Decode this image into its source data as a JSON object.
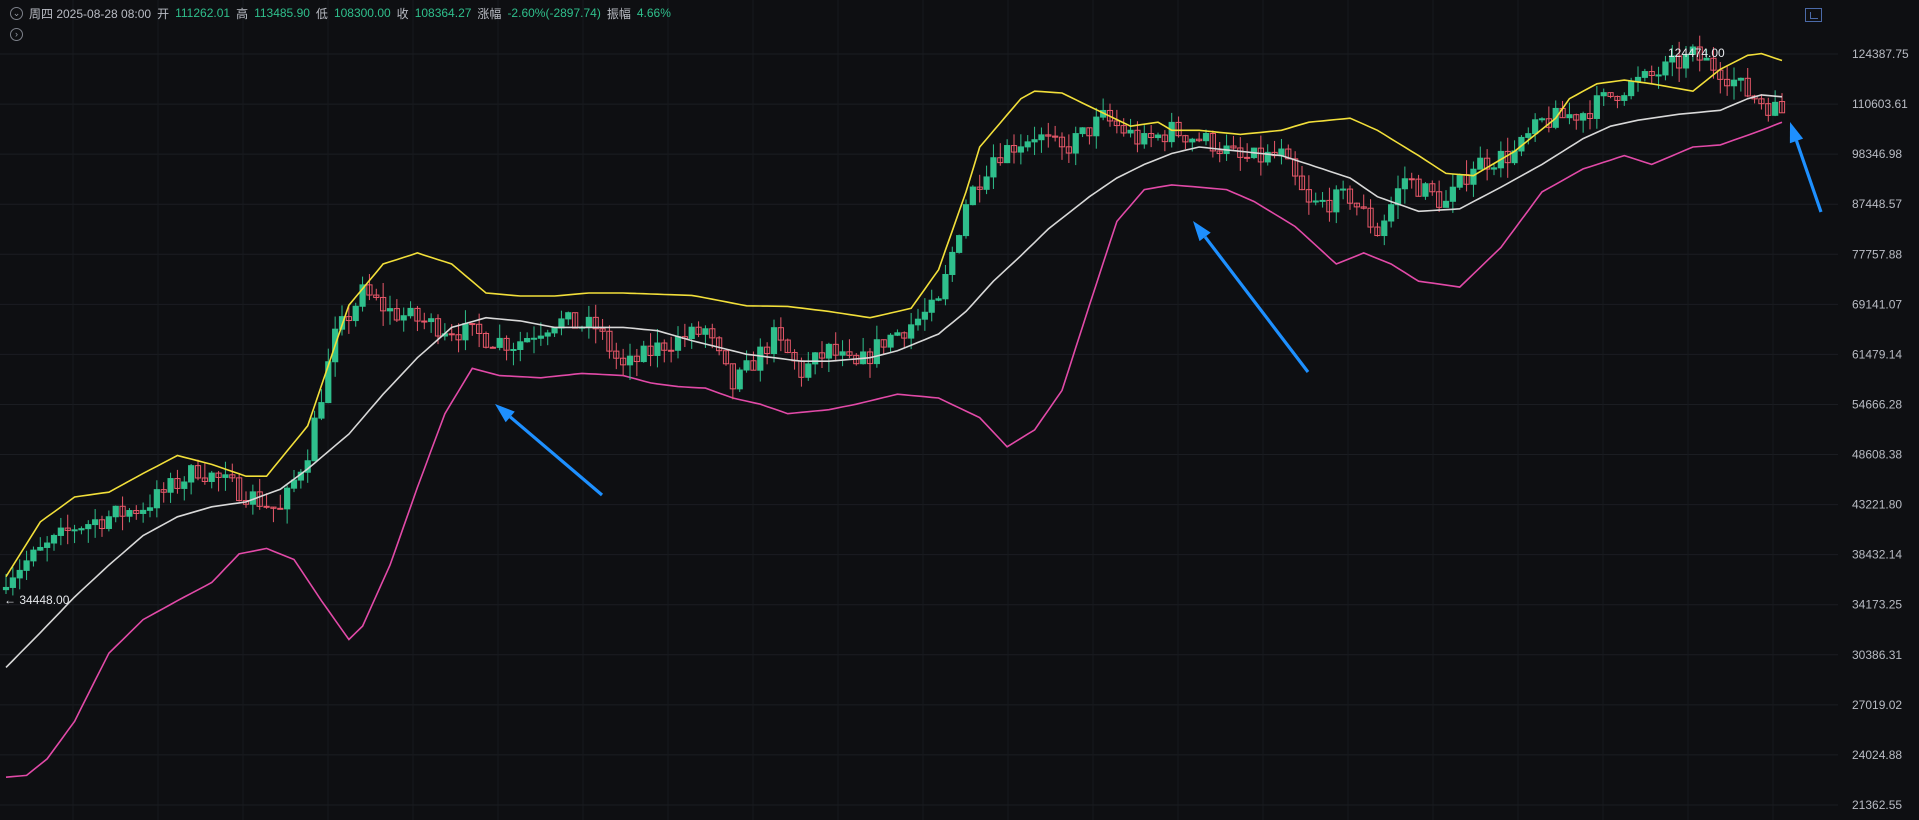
{
  "info_bar": {
    "date": "周四 2025-08-28 08:00",
    "open_label": "开",
    "open": "111262.01",
    "high_label": "高",
    "high": "113485.90",
    "low_label": "低",
    "low": "108300.00",
    "close_label": "收",
    "close": "108364.27",
    "change_label": "涨幅",
    "change": "-2.60%(-2897.74)",
    "amplitude_label": "振幅",
    "amplitude": "4.66%",
    "collapse_icon": "chevron-down-icon",
    "expand_icon": "chevron-right-icon"
  },
  "colors": {
    "up": "#2fbf8c",
    "down": "#e8586a",
    "upper_band": "#f2df3a",
    "middle_band": "#d8d8d8",
    "lower_band": "#e24aa8",
    "arrow": "#1e90ff",
    "background": "#0e0f12"
  },
  "chart_data": {
    "type": "candlestick",
    "y_axis_scale": "log",
    "ylim": [
      21362.55,
      130000
    ],
    "y_ticks": [
      "124387.75",
      "110603.61",
      "98346.98",
      "87448.57",
      "77757.88",
      "69141.07",
      "61479.14",
      "54666.28",
      "48608.38",
      "43221.80",
      "38432.14",
      "34173.25",
      "30386.31",
      "27019.02",
      "24024.88",
      "21362.55"
    ],
    "annotations": {
      "high_label": "124474.00",
      "low_label": "← 34448.00"
    },
    "series": [
      {
        "name": "upper",
        "x": [
          0,
          5,
          10,
          15,
          20,
          25,
          30,
          35,
          38,
          44,
          50,
          55,
          60,
          65,
          70,
          75,
          80,
          85,
          90,
          95,
          100,
          102,
          108,
          114,
          120,
          126,
          132,
          136,
          140,
          142,
          148,
          150,
          154,
          158,
          164,
          168,
          170,
          174,
          180,
          186,
          190,
          196,
          200,
          206,
          210,
          214,
          220,
          226,
          228,
          232,
          236,
          240,
          246,
          250,
          254,
          256,
          259
        ],
        "values": [
          36500,
          41500,
          44000,
          44500,
          46500,
          48500,
          47500,
          46200,
          46200,
          52000,
          69000,
          76000,
          78000,
          76000,
          71000,
          70500,
          70500,
          71000,
          71000,
          70800,
          70600,
          70200,
          68900,
          68800,
          68000,
          67000,
          68500,
          75000,
          90000,
          100000,
          112000,
          114000,
          113500,
          110000,
          105000,
          106000,
          104000,
          104000,
          103000,
          104000,
          106000,
          107000,
          104000,
          98000,
          94000,
          93500,
          99000,
          107000,
          112000,
          116000,
          117000,
          116000,
          114000,
          120000,
          124000,
          124500,
          122500
        ]
      },
      {
        "name": "middle",
        "x": [
          0,
          5,
          10,
          15,
          20,
          25,
          30,
          35,
          40,
          44,
          50,
          55,
          60,
          65,
          70,
          75,
          80,
          85,
          90,
          95,
          100,
          104,
          108,
          112,
          116,
          120,
          126,
          130,
          136,
          140,
          144,
          148,
          152,
          158,
          162,
          166,
          170,
          174,
          180,
          186,
          190,
          196,
          200,
          206,
          212,
          218,
          224,
          230,
          234,
          238,
          244,
          250,
          254,
          256,
          259
        ],
        "values": [
          29500,
          32000,
          34800,
          37500,
          40200,
          42000,
          43000,
          43500,
          44800,
          47000,
          51000,
          56000,
          61000,
          65500,
          67000,
          66500,
          65500,
          65500,
          65500,
          65000,
          63500,
          62500,
          61500,
          61000,
          60500,
          60500,
          61000,
          62000,
          64500,
          68000,
          73000,
          77500,
          82500,
          89000,
          93000,
          96000,
          98500,
          100000,
          99000,
          98000,
          96000,
          93000,
          89000,
          86000,
          86500,
          91000,
          96000,
          102000,
          105000,
          106500,
          108000,
          109000,
          112000,
          113000,
          112500
        ]
      },
      {
        "name": "lower",
        "x": [
          0,
          3,
          6,
          10,
          15,
          20,
          25,
          30,
          34,
          38,
          42,
          46,
          50,
          52,
          56,
          60,
          64,
          68,
          72,
          78,
          84,
          90,
          94,
          98,
          102,
          106,
          110,
          114,
          120,
          124,
          130,
          136,
          142,
          146,
          150,
          154,
          158,
          162,
          166,
          170,
          174,
          178,
          182,
          188,
          194,
          198,
          202,
          206,
          212,
          218,
          224,
          230,
          236,
          240,
          246,
          250,
          256,
          259
        ],
        "values": [
          22800,
          22900,
          23800,
          26000,
          30500,
          33000,
          34500,
          36000,
          38500,
          39000,
          38000,
          34500,
          31500,
          32500,
          37500,
          45000,
          53500,
          59500,
          58500,
          58200,
          58800,
          58500,
          57500,
          57000,
          56800,
          55500,
          54700,
          53500,
          54000,
          54700,
          56000,
          55500,
          53000,
          49500,
          51500,
          56500,
          69000,
          84000,
          90500,
          91500,
          91000,
          90500,
          88000,
          83000,
          76000,
          78000,
          76000,
          73000,
          72000,
          79000,
          90000,
          95000,
          98000,
          96000,
          100000,
          100500,
          104000,
          106000
        ]
      }
    ],
    "candles_visible": 260,
    "candle_path_x": [
      0,
      10,
      20,
      28,
      36,
      40,
      44,
      48,
      52,
      56,
      62,
      68,
      74,
      80,
      86,
      90,
      96,
      102,
      106,
      112,
      116,
      120,
      124,
      128,
      132,
      136,
      140,
      144,
      150,
      154,
      160,
      166,
      170,
      176,
      180,
      186,
      190,
      196,
      200,
      204,
      210,
      214,
      220,
      224,
      230,
      236,
      240,
      246,
      250,
      254,
      259
    ],
    "candle_path_close": [
      36500,
      41000,
      43000,
      47000,
      44000,
      42500,
      49000,
      64000,
      71000,
      68000,
      66000,
      64500,
      63000,
      66500,
      65500,
      59500,
      63000,
      65000,
      57000,
      64000,
      59000,
      62000,
      59500,
      63500,
      66000,
      69000,
      88000,
      98000,
      103000,
      99000,
      107000,
      101000,
      104000,
      101000,
      97000,
      98000,
      87000,
      89000,
      82000,
      93000,
      87500,
      96000,
      98500,
      106000,
      108500,
      115000,
      118000,
      124000,
      120000,
      113500,
      108400
    ],
    "last_candle": {
      "open": 111262.01,
      "high": 113485.9,
      "low": 108300.0,
      "close": 108364.27
    }
  }
}
